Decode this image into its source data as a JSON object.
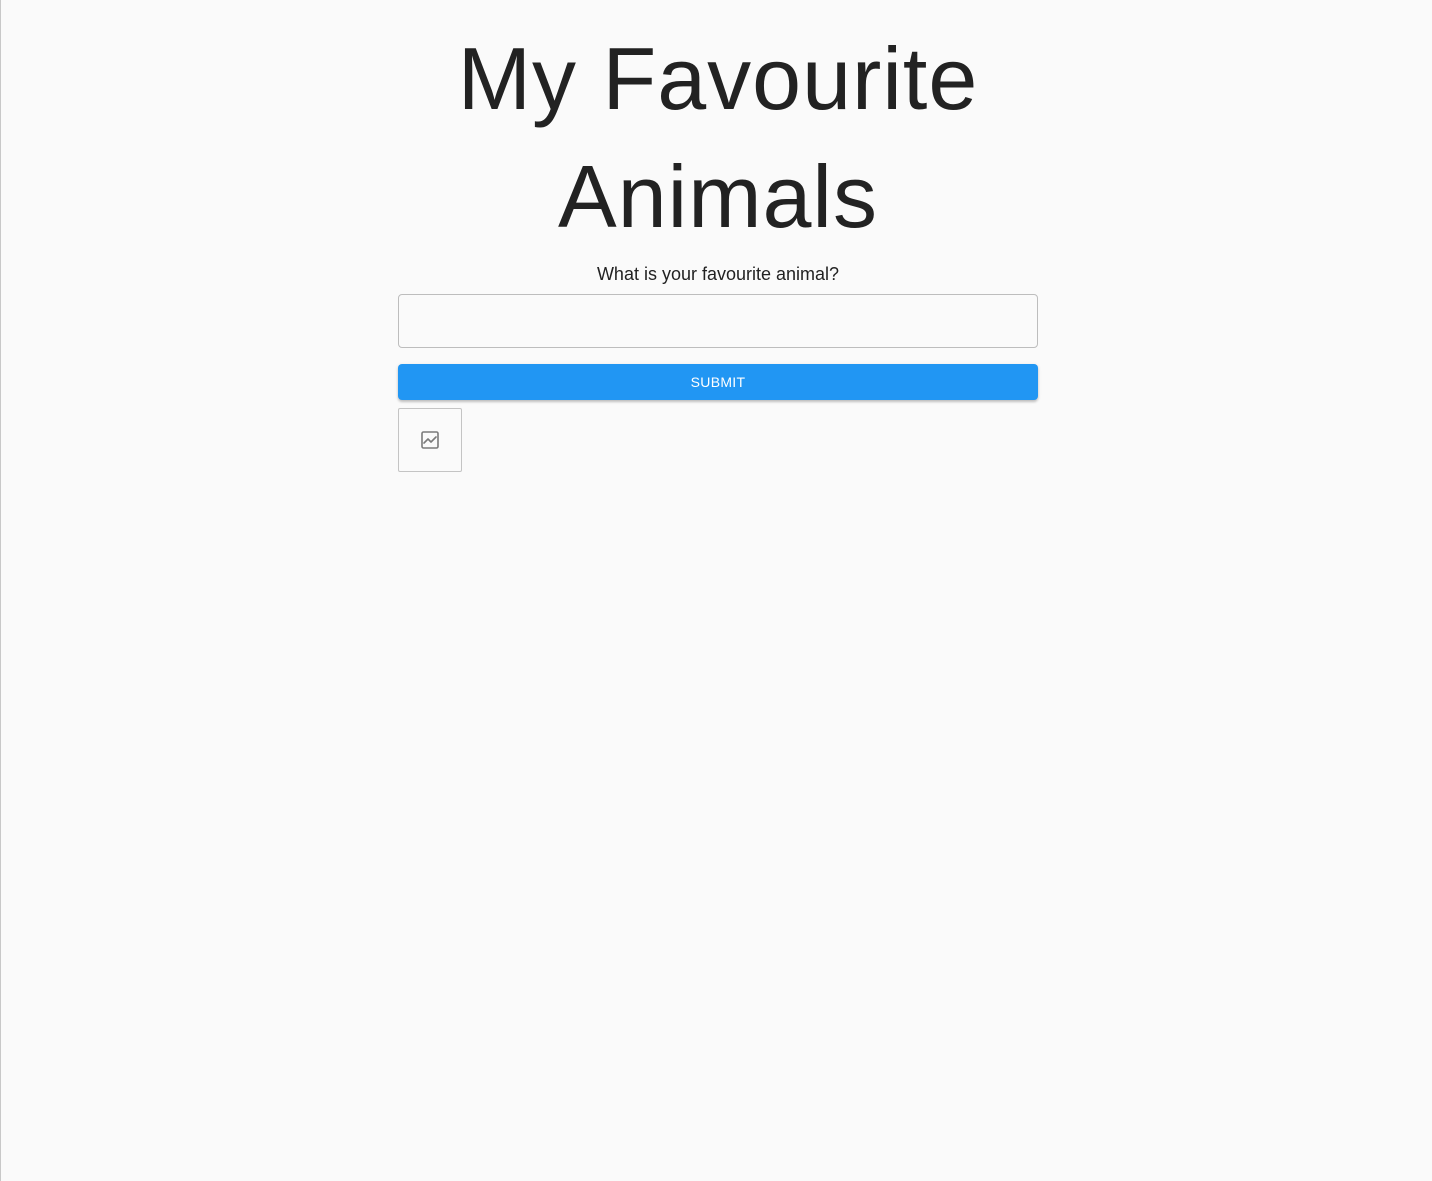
{
  "page": {
    "title": "My Favourite Animals",
    "question": "What is your favourite animal?"
  },
  "form": {
    "input_value": "",
    "input_placeholder": "",
    "submit_label": "SUBMIT"
  },
  "image_placeholder": {
    "icon": "image-icon"
  },
  "colors": {
    "background": "#fafafa",
    "accent": "#2196f3",
    "text": "#222222",
    "border": "#bdbdbd"
  }
}
